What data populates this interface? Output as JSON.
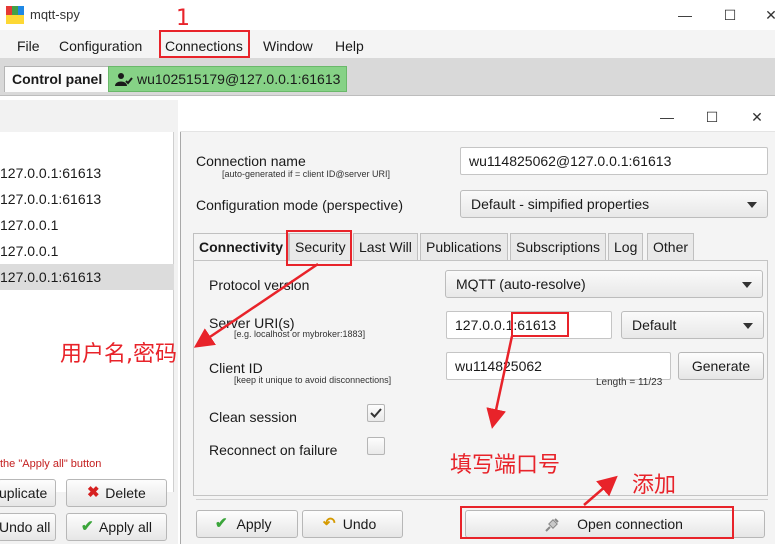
{
  "window": {
    "title": "mqtt-spy",
    "logo_text": "spy",
    "controls": {
      "minimize": "—",
      "maximize": "☐",
      "close": "✕"
    }
  },
  "menu": {
    "items": [
      "File",
      "Configuration",
      "Connections",
      "Window",
      "Help"
    ]
  },
  "tabs": {
    "control_panel": "Control panel",
    "connection": "wu102515179@127.0.0.1:61613"
  },
  "left_panel": {
    "rows": [
      "127.0.0.1:61613",
      "127.0.0.1:61613",
      "127.0.0.1",
      "127.0.0.1",
      "127.0.0.1:61613"
    ],
    "selected_index": 4,
    "hint": "the \"Apply all\" button",
    "buttons": {
      "duplicate": "uplicate",
      "delete": "Delete",
      "undo_all": "Undo all",
      "apply_all": "Apply all"
    }
  },
  "dialog": {
    "controls": {
      "minimize": "—",
      "maximize": "☐",
      "close": "✕"
    },
    "connection_name": {
      "label": "Connection name",
      "hint": "[auto-generated if = client ID@server URI]",
      "value": "wu114825062@127.0.0.1:61613"
    },
    "configuration_mode": {
      "label": "Configuration mode (perspective)",
      "value": "Default - simpified properties"
    },
    "subtabs": [
      "Connectivity",
      "Security",
      "Last Will",
      "Publications",
      "Subscriptions",
      "Log",
      "Other"
    ],
    "active_subtab": "Connectivity",
    "protocol_version": {
      "label": "Protocol version",
      "value": "MQTT (auto-resolve)"
    },
    "server_uri": {
      "label": "Server URI(s)",
      "hint": "[e.g. localhost or mybroker:1883]",
      "value": "127.0.0.1:61613",
      "mode": "Default"
    },
    "client_id": {
      "label": "Client ID",
      "hint": "[keep it unique to avoid disconnections]",
      "value": "wu114825062",
      "length": "Length = 11/23",
      "generate": "Generate"
    },
    "clean_session": {
      "label": "Clean session",
      "checked": true
    },
    "reconnect": {
      "label": "Reconnect on failure",
      "checked": false
    },
    "buttons": {
      "apply": "Apply",
      "undo": "Undo",
      "open": "Open connection"
    }
  },
  "annotations": {
    "step1": "1",
    "security_note": "用户名,密码",
    "port_note": "填写端口号",
    "add_note": "添加"
  },
  "colors": {
    "annotation": "#e8232a",
    "connection_tab": "#86d286",
    "delete_icon": "#d62020",
    "apply_icon": "#3aa53a"
  }
}
